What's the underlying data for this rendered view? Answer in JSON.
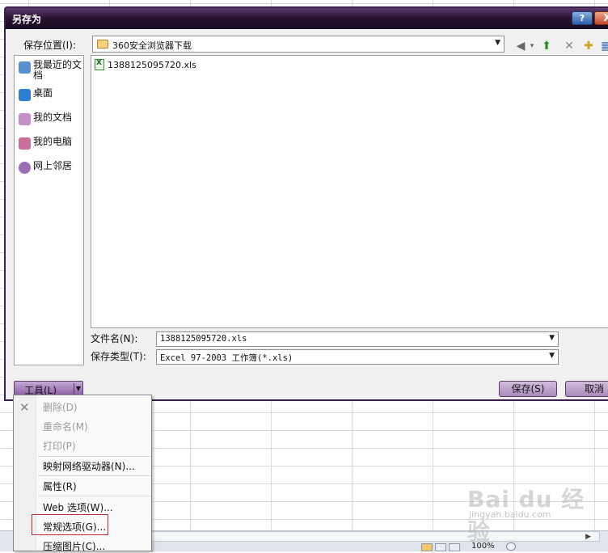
{
  "dialog": {
    "title": "另存为",
    "help_label": "?",
    "close_label": "X",
    "save_in_label": "保存位置(I):",
    "save_in_value": "360安全浏览器下载",
    "filename_label": "文件名(N):",
    "filename_value": "1388125095720.xls",
    "filetype_label": "保存类型(T):",
    "filetype_value": "Excel 97-2003 工作簿(*.xls)",
    "tools_label": "工具(L)",
    "save_label": "保存(S)",
    "cancel_label": "取消"
  },
  "places": [
    {
      "label": "我最近的文档",
      "icon": "recent-docs-icon",
      "color": "#5b8fd0"
    },
    {
      "label": "桌面",
      "icon": "desktop-icon",
      "color": "#2d7fd4"
    },
    {
      "label": "我的文档",
      "icon": "my-documents-icon",
      "color": "#c590c9"
    },
    {
      "label": "我的电脑",
      "icon": "my-computer-icon",
      "color": "#c8709a"
    },
    {
      "label": "网上邻居",
      "icon": "network-icon",
      "color": "#9a6fb7"
    }
  ],
  "files": [
    {
      "name": "1388125095720.xls",
      "icon": "excel-file-icon"
    }
  ],
  "tools_menu": {
    "items": [
      {
        "label": "删除(D)",
        "enabled": false
      },
      {
        "label": "重命名(M)",
        "enabled": false
      },
      {
        "label": "打印(P)",
        "enabled": false
      },
      {
        "label": "映射网络驱动器(N)...",
        "enabled": true
      },
      {
        "label": "属性(R)",
        "enabled": true
      },
      {
        "label": "Web 选项(W)...",
        "enabled": true
      },
      {
        "label": "常规选项(G)...",
        "enabled": true,
        "highlighted": true
      },
      {
        "label": "压缩图片(C)...",
        "enabled": true
      }
    ]
  },
  "status": {
    "zoom": "100%"
  },
  "watermark": {
    "brand": "Bai du 经验",
    "url": "jingyan.baidu.com"
  },
  "colors": {
    "titlebar": "#2a1435",
    "accent": "#a98bbb",
    "highlight_border": "#c2292d"
  }
}
